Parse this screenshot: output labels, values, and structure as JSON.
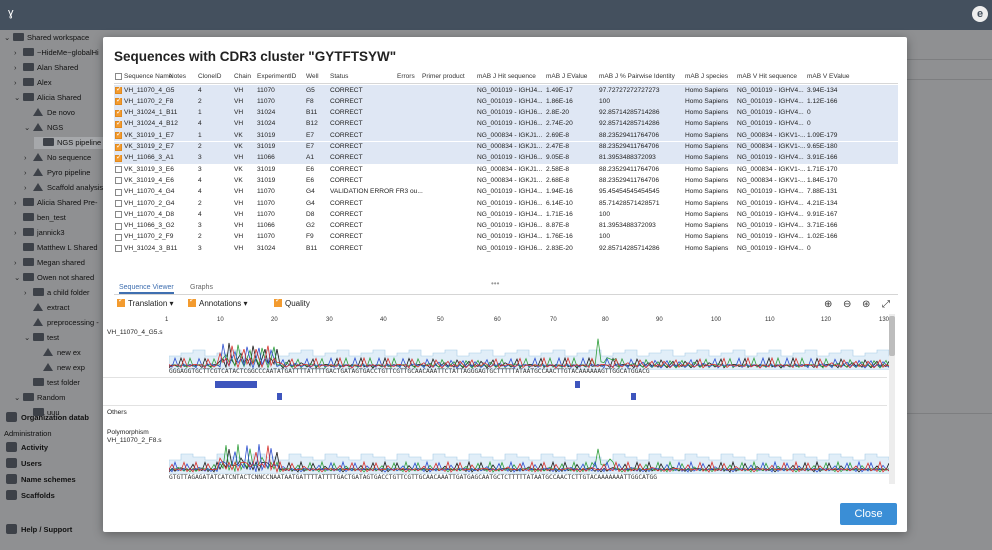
{
  "app": {
    "logo_glyph": "ɣ",
    "user_glyph": "e"
  },
  "sidebar": {
    "items": [
      {
        "label": "Shared workspace",
        "caret": "⌄",
        "depth": 0,
        "icon": "folder-user-icon"
      },
      {
        "label": "~HideMe~globalHi",
        "caret": "›",
        "depth": 1,
        "icon": "user-folder-icon"
      },
      {
        "label": "Alan Shared",
        "caret": "›",
        "depth": 1,
        "icon": "user-folder-icon"
      },
      {
        "label": "Alex",
        "caret": "›",
        "depth": 1,
        "icon": "user-folder-icon"
      },
      {
        "label": "Alicia Shared",
        "caret": "⌄",
        "depth": 1,
        "icon": "user-folder-icon"
      },
      {
        "label": "De novo",
        "caret": "",
        "depth": 2,
        "icon": "flask-icon"
      },
      {
        "label": "NGS",
        "caret": "⌄",
        "depth": 2,
        "icon": "flask-icon"
      },
      {
        "label": "NGS pipeline r",
        "caret": "",
        "depth": 3,
        "icon": "table-icon"
      },
      {
        "label": "No sequence",
        "caret": "›",
        "depth": 2,
        "icon": "flask-icon"
      },
      {
        "label": "Pyro pipeline",
        "caret": "›",
        "depth": 2,
        "icon": "flask-icon"
      },
      {
        "label": "Scaffold analysis",
        "caret": "›",
        "depth": 2,
        "icon": "flask-icon"
      },
      {
        "label": "Alicia Shared Pre-",
        "caret": "›",
        "depth": 1,
        "icon": "user-folder-icon"
      },
      {
        "label": "ben_test",
        "caret": "",
        "depth": 1,
        "icon": "folder-icon"
      },
      {
        "label": "jannick3",
        "caret": "›",
        "depth": 1,
        "icon": "user-folder-icon"
      },
      {
        "label": "Matthew L Shared",
        "caret": "",
        "depth": 1,
        "icon": "user-folder-icon"
      },
      {
        "label": "Megan shared",
        "caret": "›",
        "depth": 1,
        "icon": "user-folder-icon"
      },
      {
        "label": "Owen not shared",
        "caret": "⌄",
        "depth": 1,
        "icon": "folder-icon"
      },
      {
        "label": "a child folder",
        "caret": "›",
        "depth": 2,
        "icon": "folder-icon"
      },
      {
        "label": "extract",
        "caret": "",
        "depth": 2,
        "icon": "flask-icon"
      },
      {
        "label": "preprocessing -",
        "caret": "",
        "depth": 2,
        "icon": "flask-icon"
      },
      {
        "label": "test",
        "caret": "⌄",
        "depth": 2,
        "icon": "folder-icon"
      },
      {
        "label": "new ex",
        "caret": "",
        "depth": 3,
        "icon": "flask-icon"
      },
      {
        "label": "new exp",
        "caret": "",
        "depth": 3,
        "icon": "flask-icon"
      },
      {
        "label": "test folder",
        "caret": "",
        "depth": 2,
        "icon": "folder-icon"
      },
      {
        "label": "Random",
        "caret": "⌄",
        "depth": 1,
        "icon": "user-folder-icon"
      },
      {
        "label": "uuu",
        "caret": "",
        "depth": 2,
        "icon": "table-icon"
      }
    ],
    "org": "Organization datab",
    "admin_header": "Administration",
    "admin_items": [
      "Activity",
      "Users",
      "Name schemes",
      "Scaffolds"
    ],
    "help": "Help / Support"
  },
  "modal": {
    "title": "Sequences with CDR3 cluster \"GYTFTSYW\"",
    "columns": [
      "Sequence Name",
      "Notes",
      "CloneID",
      "Chain",
      "ExperimentID",
      "Well",
      "Status",
      "Errors",
      "Primer product",
      "mAB J Hit sequence",
      "mAB J EValue",
      "mAB J % Pairwise Identity",
      "mAB J species",
      "mAB V Hit sequence",
      "mAB V EValue"
    ],
    "rows": [
      {
        "sel": true,
        "name": "VH_11070_4_G5",
        "clone": "4",
        "chain": "VH",
        "exp": "11070",
        "well": "G5",
        "status": "CORRECT",
        "jhit": "NG_001019 - IGHJ4...",
        "jev": "1.49E-17",
        "jpid": "97.72727272727273",
        "species": "Homo Sapiens",
        "vhit": "NG_001019 - IGHV4...",
        "vev": "3.94E-134"
      },
      {
        "sel": true,
        "name": "VH_11070_2_F8",
        "clone": "2",
        "chain": "VH",
        "exp": "11070",
        "well": "F8",
        "status": "CORRECT",
        "jhit": "NG_001019 - IGHJ4...",
        "jev": "1.86E-16",
        "jpid": "100",
        "species": "Homo Sapiens",
        "vhit": "NG_001019 - IGHV4...",
        "vev": "1.12E-166"
      },
      {
        "sel": true,
        "name": "VH_31024_1_B11",
        "clone": "1",
        "chain": "VH",
        "exp": "31024",
        "well": "B11",
        "status": "CORRECT",
        "jhit": "NG_001019 - IGHJ6...",
        "jev": "2.8E-20",
        "jpid": "92.85714285714286",
        "species": "Homo Sapiens",
        "vhit": "NG_001019 - IGHV4...",
        "vev": "0"
      },
      {
        "sel": true,
        "name": "VH_31024_4_B12",
        "clone": "4",
        "chain": "VH",
        "exp": "31024",
        "well": "B12",
        "status": "CORRECT",
        "jhit": "NG_001019 - IGHJ6...",
        "jev": "2.74E-20",
        "jpid": "92.85714285714286",
        "species": "Homo Sapiens",
        "vhit": "NG_001019 - IGHV4...",
        "vev": "0"
      },
      {
        "sel": true,
        "name": "VK_31019_1_E7",
        "clone": "1",
        "chain": "VK",
        "exp": "31019",
        "well": "E7",
        "status": "CORRECT",
        "jhit": "NG_000834 - IGKJ1...",
        "jev": "2.69E-8",
        "jpid": "88.23529411764706",
        "species": "Homo Sapiens",
        "vhit": "NG_000834 - IGKV1-...",
        "vev": "1.09E-179"
      },
      {
        "sel": true,
        "name": "VK_31019_2_E7",
        "clone": "2",
        "chain": "VK",
        "exp": "31019",
        "well": "E7",
        "status": "CORRECT",
        "jhit": "NG_000834 - IGKJ1...",
        "jev": "2.47E-8",
        "jpid": "88.23529411764706",
        "species": "Homo Sapiens",
        "vhit": "NG_000834 - IGKV1-...",
        "vev": "9.65E-180"
      },
      {
        "sel": true,
        "name": "VH_11066_3_A1",
        "clone": "3",
        "chain": "VH",
        "exp": "11066",
        "well": "A1",
        "status": "CORRECT",
        "jhit": "NG_001019 - IGHJ6...",
        "jev": "9.05E-8",
        "jpid": "81.3953488372093",
        "species": "Homo Sapiens",
        "vhit": "NG_001019 - IGHV4...",
        "vev": "3.91E-166"
      },
      {
        "sel": false,
        "name": "VK_31019_3_E6",
        "clone": "3",
        "chain": "VK",
        "exp": "31019",
        "well": "E6",
        "status": "CORRECT",
        "jhit": "NG_000834 - IGKJ1...",
        "jev": "2.58E-8",
        "jpid": "88.23529411764706",
        "species": "Homo Sapiens",
        "vhit": "NG_000834 - IGKV1-...",
        "vev": "1.71E-170"
      },
      {
        "sel": false,
        "name": "VK_31019_4_E6",
        "clone": "4",
        "chain": "VK",
        "exp": "31019",
        "well": "E6",
        "status": "CORRECT",
        "jhit": "NG_000834 - IGKJ1...",
        "jev": "2.68E-8",
        "jpid": "88.23529411764706",
        "species": "Homo Sapiens",
        "vhit": "NG_000834 - IGKV1-...",
        "vev": "1.84E-170"
      },
      {
        "sel": false,
        "name": "VH_11070_4_G4",
        "clone": "4",
        "chain": "VH",
        "exp": "11070",
        "well": "G4",
        "status": "VALIDATION ERROR FR3 ou...",
        "jhit": "NG_001019 - IGHJ4...",
        "jev": "1.94E-16",
        "jpid": "95.45454545454545",
        "species": "Homo Sapiens",
        "vhit": "NG_001019 - IGHV4...",
        "vev": "7.88E-131"
      },
      {
        "sel": false,
        "name": "VH_11070_2_G4",
        "clone": "2",
        "chain": "VH",
        "exp": "11070",
        "well": "G4",
        "status": "CORRECT",
        "jhit": "NG_001019 - IGHJ6...",
        "jev": "6.14E-10",
        "jpid": "85.71428571428571",
        "species": "Homo Sapiens",
        "vhit": "NG_001019 - IGHV4...",
        "vev": "4.21E-134"
      },
      {
        "sel": false,
        "name": "VH_11070_4_D8",
        "clone": "4",
        "chain": "VH",
        "exp": "11070",
        "well": "D8",
        "status": "CORRECT",
        "jhit": "NG_001019 - IGHJ4...",
        "jev": "1.71E-16",
        "jpid": "100",
        "species": "Homo Sapiens",
        "vhit": "NG_001019 - IGHV4...",
        "vev": "9.91E-167"
      },
      {
        "sel": false,
        "name": "VH_11066_3_G2",
        "clone": "3",
        "chain": "VH",
        "exp": "11066",
        "well": "G2",
        "status": "CORRECT",
        "jhit": "NG_001019 - IGHJ6...",
        "jev": "8.87E-8",
        "jpid": "81.3953488372093",
        "species": "Homo Sapiens",
        "vhit": "NG_001019 - IGHV4...",
        "vev": "3.71E-166"
      },
      {
        "sel": false,
        "name": "VH_11070_2_F9",
        "clone": "2",
        "chain": "VH",
        "exp": "11070",
        "well": "F9",
        "status": "CORRECT",
        "jhit": "NG_001019 - IGHJ4...",
        "jev": "1.76E-16",
        "jpid": "100",
        "species": "Homo Sapiens",
        "vhit": "NG_001019 - IGHV4...",
        "vev": "1.02E-166"
      },
      {
        "sel": false,
        "name": "VH_31024_3_B11",
        "clone": "3",
        "chain": "VH",
        "exp": "31024",
        "well": "B11",
        "status": "CORRECT",
        "jhit": "NG_001019 - IGHJ6...",
        "jev": "2.83E-20",
        "jpid": "92.85714285714286",
        "species": "Homo Sapiens",
        "vhit": "NG_001019 - IGHV4...",
        "vev": "0"
      }
    ],
    "splitter": "•••",
    "tabs": [
      "Sequence Viewer",
      "Graphs"
    ],
    "toolbar": {
      "translation": "Translation",
      "annotations": "Annotations",
      "quality": "Quality"
    },
    "ruler": [
      "1",
      "10",
      "20",
      "30",
      "40",
      "50",
      "60",
      "70",
      "80",
      "90",
      "100",
      "110",
      "120",
      "130"
    ],
    "track1_label": "VH_11070_4_G5.s",
    "track1_seq": "GGGAGGTGCTTCGTCATACTCGGCCCAATATGATTTTATTTTGACTGATAGTGACCTGTTCGTTGCAACAAATTCTATTAGGGAGTGCTTTTTATAATGCCAACTTGTACAAAAAAGTTGGCATGGACG",
    "others_label": "Others",
    "poly_label": "Polymorphism",
    "track2_label": "VH_11070_2_F8.s",
    "track2_seq": "GTGTTAGAGATATCATCNTACTCNNCCNAATAATGATTTTATTTTGACTGATAGTGACCTGTTCGTTGCAACAAATTGATGAGCAATGCTCTTTTTATAATGCCAACTCTTGTACAAAAAAATTGGCATGG",
    "close_label": "Close",
    "colors": {
      "accent": "#3a8ed6",
      "checkbox": "#f39b2f",
      "selected_row": "#dfe7f4",
      "bar": "#3e55bd"
    }
  }
}
